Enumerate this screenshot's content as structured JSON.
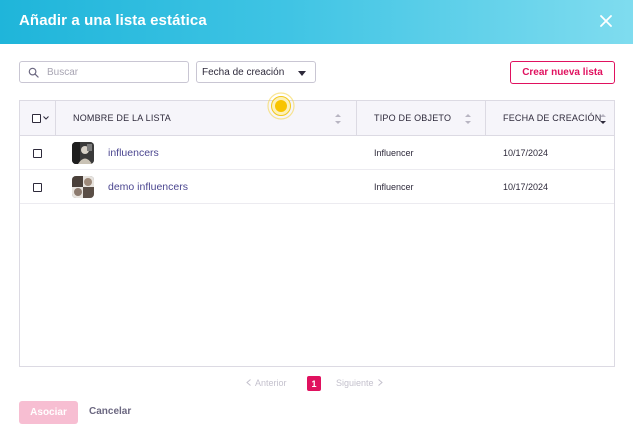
{
  "dialog": {
    "title": "Añadir a una lista estática",
    "close_icon": "close-icon",
    "accent_color": "#e0115f",
    "header_gradient": [
      "#1fb5da",
      "#7fdcef"
    ]
  },
  "toolbar": {
    "search_placeholder": "Buscar",
    "search_value": "",
    "search_icon": "search-icon",
    "sort_selected": "Fecha de creación",
    "create_button": "Crear nueva lista"
  },
  "table": {
    "columns": {
      "name": "NOMBRE DE LA LISTA",
      "type": "TIPO DE OBJETO",
      "date": "FECHA DE CREACIÓN"
    },
    "rows": [
      {
        "name": "influencers",
        "type": "Influencer",
        "date": "10/17/2024",
        "checked": false
      },
      {
        "name": "demo influencers",
        "type": "Influencer",
        "date": "10/17/2024",
        "checked": false
      }
    ]
  },
  "pagination": {
    "prev_label": "Anterior",
    "current_page": "1",
    "next_label": "Siguiente"
  },
  "footer": {
    "associate_label": "Asociar",
    "cancel_label": "Cancelar"
  }
}
